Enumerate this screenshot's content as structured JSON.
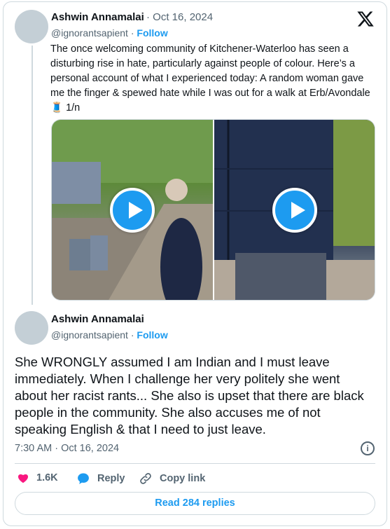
{
  "tweet1": {
    "author_name": "Ashwin Annamalai",
    "date_sep": "·",
    "date": "Oct 16, 2024",
    "handle": "@ignorantsapient",
    "handle_sep": "·",
    "follow_label": "Follow",
    "text": "The once welcoming community of Kitchener-Waterloo has seen a disturbing rise in hate, particularly against people of colour. Here’s a personal account of what I experienced today: A random woman gave me the  finger & spewed hate while I was out for a walk at Erb/Avondale 🧵 1/n",
    "media": [
      {
        "type": "video",
        "icon": "play-icon"
      },
      {
        "type": "video",
        "icon": "play-icon"
      }
    ]
  },
  "tweet2": {
    "author_name": "Ashwin Annamalai",
    "handle": "@ignorantsapient",
    "handle_sep": "·",
    "follow_label": "Follow",
    "text": "She WRONGLY assumed I am Indian and I must leave immediately. When I challenge her very politely she went about her racist rants... She also is upset that there are black people in the community. She also accuses me of not speaking English & that I need to just leave.",
    "timestamp": "7:30 AM · Oct 16, 2024"
  },
  "actions": {
    "likes": "1.6K",
    "reply_label": "Reply",
    "copy_link_label": "Copy link",
    "read_replies_label": "Read 284 replies"
  },
  "colors": {
    "accent": "#1d9bf0",
    "like": "#f91880",
    "text": "#0f1419",
    "muted": "#536471",
    "border": "#cfd9de"
  },
  "icons": [
    "x-logo-icon",
    "play-icon",
    "info-icon",
    "heart-icon",
    "reply-bubble-icon",
    "link-icon"
  ]
}
